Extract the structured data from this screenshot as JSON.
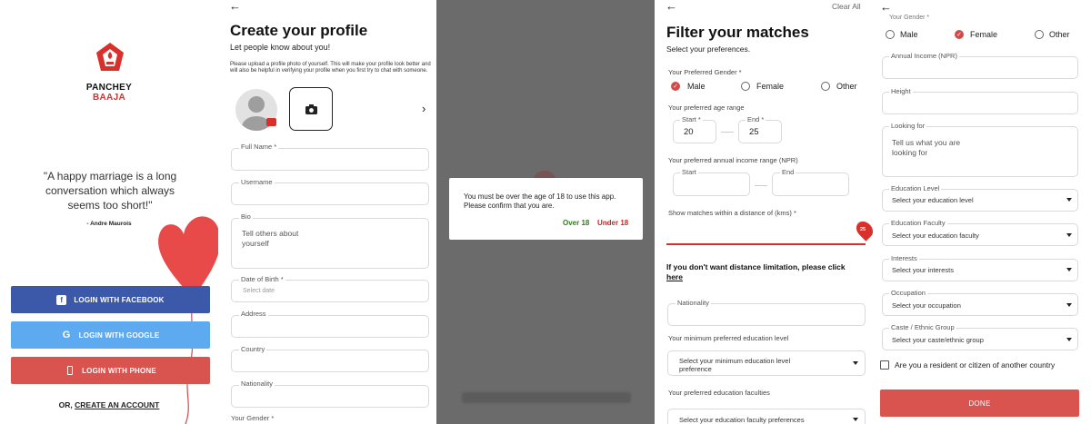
{
  "welcome": {
    "brand_line1": "PANCHEY",
    "brand_line2": "BAAJA",
    "quote": "\"A happy marriage is a long conversation which always seems too short!\"",
    "quote_author": "- Andre Maurois",
    "facebook_label": "LOGIN WITH FACEBOOK",
    "google_label": "LOGIN WITH GOOGLE",
    "phone_label": "LOGIN WITH PHONE",
    "create_prefix": "OR, ",
    "create_link": "CREATE AN ACCOUNT",
    "colors": {
      "brand_red": "#d9302b",
      "facebook": "#3b59a8",
      "google": "#5eaaf1",
      "phone": "#d9534f"
    }
  },
  "profile": {
    "back_icon": "back-arrow-icon",
    "title": "Create your profile",
    "subtitle": "Let people know about you!",
    "instruction": "Please upload a profile photo of yourself. This will make your profile look better and will also be helpful in verifying your profile when you first try to chat with someone.",
    "fields": {
      "full_name": "Full Name *",
      "username": "Username",
      "bio": "Bio",
      "bio_placeholder": "Tell others about yourself",
      "dob": "Date of Birth *",
      "dob_placeholder": "Select date",
      "address": "Address",
      "country": "Country",
      "nationality": "Nationality",
      "gender": "Your Gender *"
    }
  },
  "age_dialog": {
    "message": "You must be over the age of 18 to use this app. Please confirm that you are.",
    "over_label": "Over 18",
    "under_label": "Under 18",
    "colors": {
      "over": "#2e7d1f",
      "under": "#c62828"
    }
  },
  "filter": {
    "title": "Filter your matches",
    "clear_all": "Clear All",
    "subtitle": "Select your preferences.",
    "gender_label": "Your Preferred Gender *",
    "gender_options": [
      "Male",
      "Female",
      "Other"
    ],
    "gender_selected": "Male",
    "age_label": "Your preferred age range",
    "age_start_label": "Start *",
    "age_start_value": "20",
    "age_end_label": "End *",
    "age_end_value": "25",
    "income_label": "Your preferred annual income range (NPR)",
    "income_start_label": "Start",
    "income_end_label": "End",
    "distance_label": "Show matches within a distance of (kms) *",
    "distance_value": "25",
    "no_limit_text": "If you don't want distance limitation, please click ",
    "no_limit_link": "here",
    "nationality_label": "Nationality",
    "min_education_label": "Your minimum preferred education level",
    "min_education_placeholder": "Select your minimum education level preference",
    "faculties_label": "Your preferred education faculties",
    "faculties_placeholder": "Select your education faculty preferences"
  },
  "details": {
    "gender_label": "Your Gender *",
    "gender_options": [
      "Male",
      "Female",
      "Other"
    ],
    "gender_selected": "Female",
    "income_label": "Annual Income (NPR)",
    "height_label": "Height",
    "looking_for_label": "Looking for",
    "looking_for_placeholder": "Tell us what you are looking for",
    "education_level_label": "Education Level",
    "education_level_placeholder": "Select your education level",
    "education_faculty_label": "Education Faculty",
    "education_faculty_placeholder": "Select your education faculty",
    "interests_label": "Interests",
    "interests_placeholder": "Select your interests",
    "occupation_label": "Occupation",
    "occupation_placeholder": "Select your occupation",
    "caste_label": "Caste / Ethnic Group",
    "caste_placeholder": "Select your caste/ethnic group",
    "resident_checkbox": "Are you a resident or citizen of another country",
    "done_label": "DONE"
  }
}
